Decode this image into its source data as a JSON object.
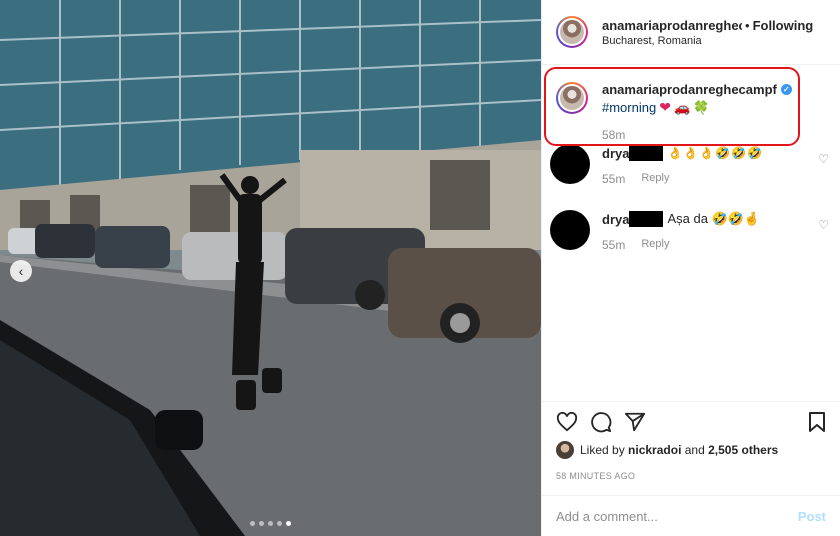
{
  "header": {
    "username": "anamariaprodanreghec",
    "separator": "•",
    "follow_status": "Following",
    "location": "Bucharest, Romania"
  },
  "caption": {
    "username": "anamariaprodanreghecampf",
    "hashtag": "#morning",
    "emoji_heart": "❤",
    "emoji_car": "🚗",
    "emoji_clover": "🍀",
    "time": "58m"
  },
  "comments": [
    {
      "user_prefix": "drya",
      "text": "👌👌👌🤣🤣🤣",
      "time": "55m",
      "reply_label": "Reply"
    },
    {
      "user_prefix": "drya",
      "text": "Așa da 🤣🤣🤞",
      "time": "55m",
      "reply_label": "Reply"
    }
  ],
  "likes": {
    "prefix": "Liked by",
    "user": "nickradoi",
    "joiner": "and",
    "count_text": "2,505 others"
  },
  "timestamp": "58 MINUTES AGO",
  "add_comment": {
    "placeholder": "Add a comment...",
    "post_label": "Post"
  },
  "colors": {
    "highlight": "#e2151b",
    "verified": "#3897f0",
    "post_disabled": "#b2dffc",
    "link": "#00376b"
  },
  "carousel": {
    "current": 5,
    "total": 5
  },
  "icons": [
    "heart-icon",
    "comment-icon",
    "share-icon",
    "save-icon",
    "verified-icon",
    "like-comment-icon",
    "prev-arrow-icon"
  ]
}
